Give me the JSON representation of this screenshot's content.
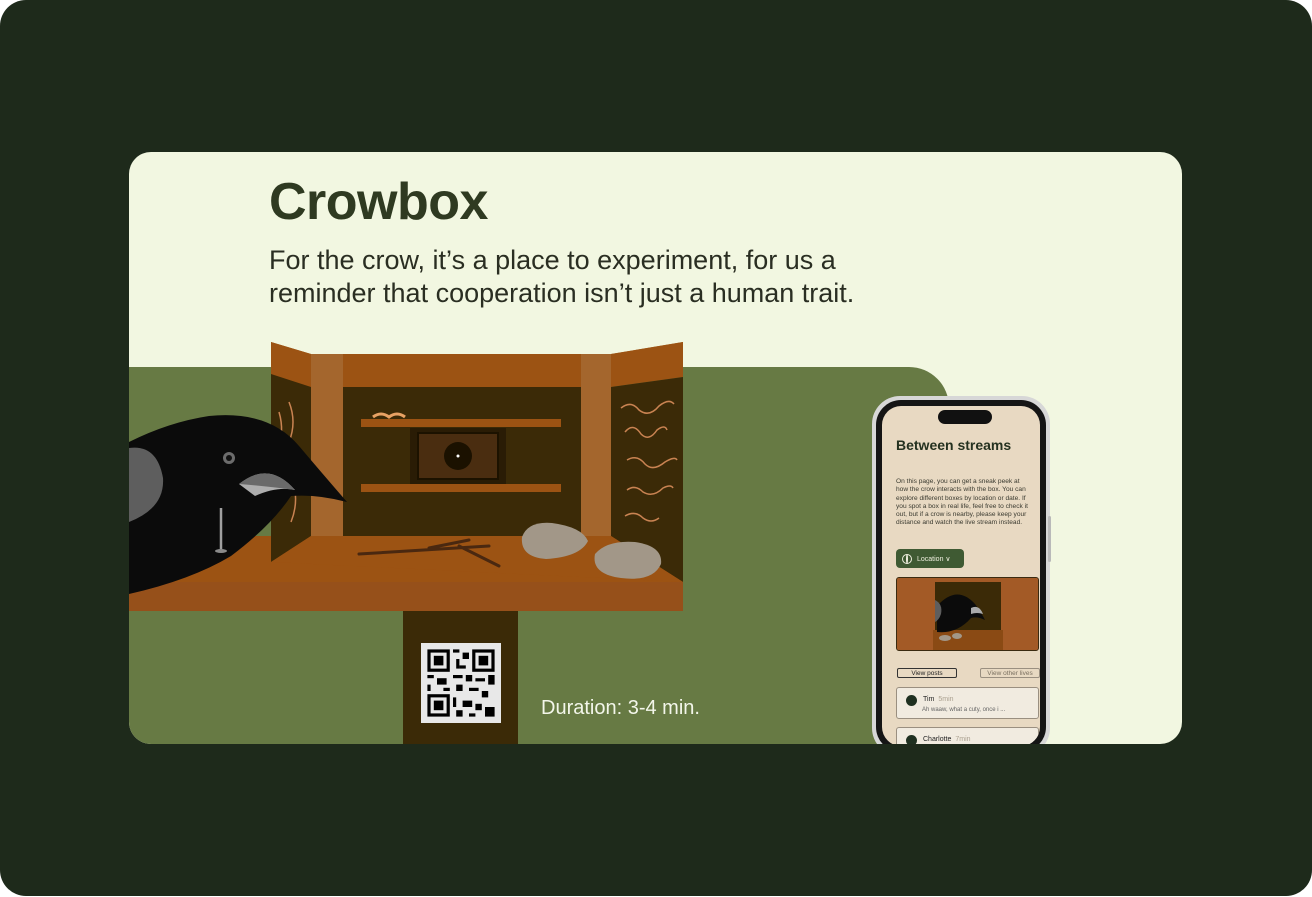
{
  "card": {
    "title": "Crowbox",
    "subtitle": "For the crow, it’s a place to experiment, for us a reminder that cooperation isn’t just a human trait.",
    "duration": "Duration: 3-4 min."
  },
  "phone": {
    "title": "Between streams",
    "body": "On this page, you can get a sneak peek at how the crow interacts with the box. You can explore different boxes by location or date. If you spot a box in real life, feel free to check it out, but if a crow is nearby, please keep your distance and watch the live stream instead.",
    "location_button": "Location ∨",
    "tabs": [
      "View posts",
      "View other lives"
    ],
    "posts": [
      {
        "name": "Tim",
        "time": "5min",
        "text": "Ah waaw, what a cuty, once i ..."
      },
      {
        "name": "Charlotte",
        "time": "7min",
        "text": ""
      }
    ]
  },
  "colors": {
    "background": "#1e2a1b",
    "card": "#f2f7e1",
    "grass": "#677a44",
    "wood": "#9c5313",
    "box_interior": "#3b2a07"
  }
}
